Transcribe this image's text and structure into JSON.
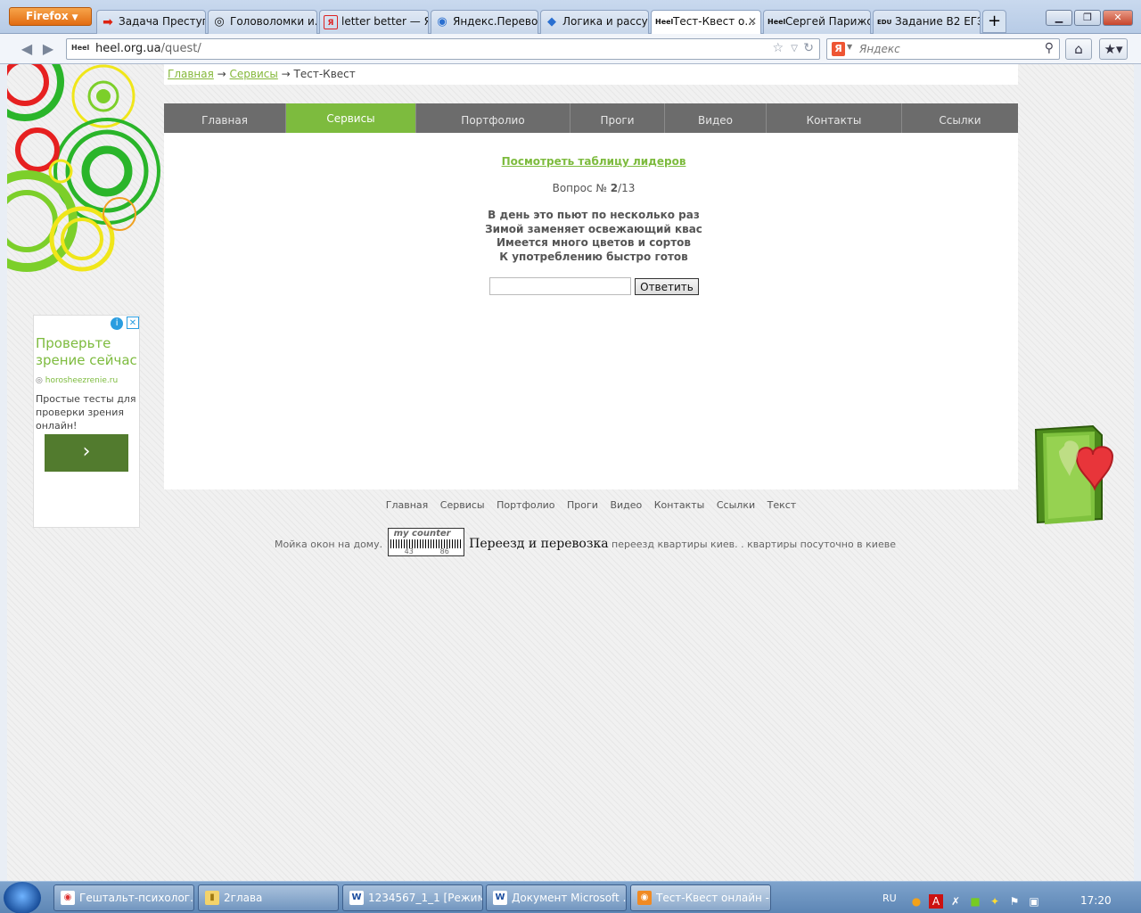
{
  "browser": {
    "menu_button": "Firefox",
    "tabs": [
      {
        "label": "Задача Преступ...",
        "fav": "➡",
        "fav_color": "#d21"
      },
      {
        "label": "Головоломки и...",
        "fav": "◎",
        "fav_color": "#222"
      },
      {
        "label": "letter better — Я...",
        "fav": "Я",
        "fav_color": "#d22"
      },
      {
        "label": "Яндекс.Перевод",
        "fav": "◉",
        "fav_color": "#2a6fd0"
      },
      {
        "label": "Логика и рассу...",
        "fav": "◆",
        "fav_color": "#2a6fd0"
      },
      {
        "label": "Тест-Квест о...",
        "fav": "Heel",
        "fav_color": "#111"
      },
      {
        "label": "Сергей Парижс...",
        "fav": "Heel",
        "fav_color": "#111"
      },
      {
        "label": "Задание В2 ЕГЭ ...",
        "fav": "EDU",
        "fav_color": "#111"
      }
    ],
    "new_tab": "+",
    "url_host": "heel.org.ua",
    "url_path": "/quest/",
    "site_favicon": "Heel",
    "search_placeholder": "Яндекс",
    "search_engine_icon": "Я"
  },
  "page": {
    "breadcrumb": {
      "home": "Главная",
      "sep1": " → ",
      "services": "Сервисы",
      "sep2": " → ",
      "current": "Тест-Квест"
    },
    "menu": [
      {
        "label": "Главная",
        "active": false
      },
      {
        "label": "Сервисы",
        "active": true
      },
      {
        "label": "Портфолио",
        "active": false
      },
      {
        "label": "Проги",
        "active": false
      },
      {
        "label": "Видео",
        "active": false
      },
      {
        "label": "Контакты",
        "active": false
      },
      {
        "label": "Ссылки",
        "active": false
      }
    ],
    "leaders_link": "Посмотреть таблицу лидеров",
    "question_prefix": "Вопрос № ",
    "question_num": "2",
    "question_total": "/13",
    "riddle": [
      "В день это пьют по несколько раз",
      "Зимой заменяет освежающий квас",
      "Имеется много цветов и сортов",
      "К употреблению быстро готов"
    ],
    "answer_value": "",
    "answer_button": "Ответить",
    "footer_links": [
      "Главная",
      "Сервисы",
      "Портфолио",
      "Проги",
      "Видео",
      "Контакты",
      "Ссылки",
      "Текст"
    ],
    "footer_text_1": "Мойка окон на дому.",
    "counter_label": "my counter",
    "counter_n1": "43",
    "counter_n2": "86",
    "footer_text_big": "Переезд и перевозка",
    "footer_text_2": "переезд квартиры киев. . квартиры посуточно в киеве"
  },
  "ad": {
    "title": "Проверьте зрение сейчас",
    "domain": "horosheezrenie.ru",
    "text": "Простые тесты для проверки зрения онлайн!",
    "button": "›",
    "info_icon": "i",
    "close_icon": "✕"
  },
  "taskbar": {
    "items": [
      {
        "label": "Гештальт-психолог...",
        "icon": "◉",
        "icon_bg": "#fff",
        "icon_color": "#d33"
      },
      {
        "label": "2глава",
        "icon": "▮",
        "icon_bg": "#f3d36b",
        "icon_color": "#a07a10"
      },
      {
        "label": "1234567_1_1 [Режим...",
        "icon": "W",
        "icon_bg": "#fff",
        "icon_color": "#1d4fa0"
      },
      {
        "label": "Документ Microsoft ...",
        "icon": "W",
        "icon_bg": "#fff",
        "icon_color": "#1d4fa0"
      },
      {
        "label": "Тест-Квест онлайн -...",
        "icon": "◉",
        "icon_bg": "#f08a24",
        "icon_color": "#fff"
      }
    ],
    "lang": "RU",
    "clock": "17:20"
  },
  "colors": {
    "accent_green": "#7dbb3e",
    "menu_gray": "#6c6c6c"
  }
}
